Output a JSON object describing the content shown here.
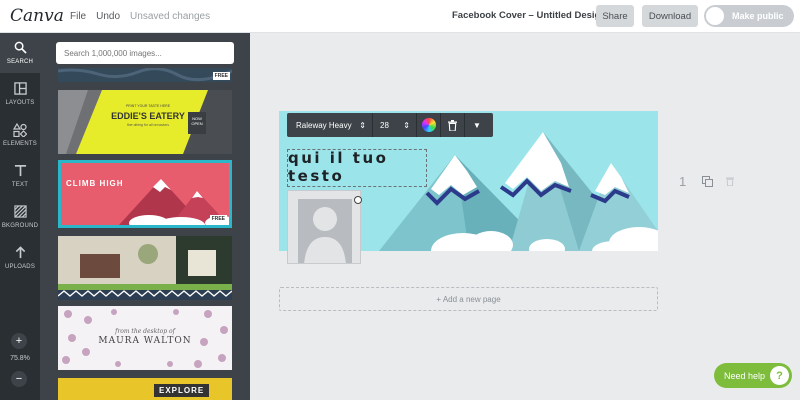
{
  "app": {
    "logo": "Canva"
  },
  "menu": {
    "file": "File",
    "undo": "Undo",
    "status": "Unsaved changes"
  },
  "header": {
    "doc_title": "Facebook Cover – Untitled Design",
    "share": "Share",
    "download": "Download",
    "make_public": "Make public"
  },
  "rail": {
    "items": [
      {
        "label": "SEARCH",
        "icon": "search-icon"
      },
      {
        "label": "LAYOUTS",
        "icon": "layouts-icon"
      },
      {
        "label": "ELEMENTS",
        "icon": "elements-icon"
      },
      {
        "label": "TEXT",
        "icon": "text-icon"
      },
      {
        "label": "BKGROUND",
        "icon": "background-icon"
      },
      {
        "label": "UPLOADS",
        "icon": "uploads-icon"
      }
    ],
    "zoom_plus": "+",
    "zoom_level": "75.8%",
    "zoom_minus": "−"
  },
  "panel": {
    "search_placeholder": "Search 1,000,000 images...",
    "free_badge": "FREE",
    "eatery_line1": "PRINT YOUR TASTE HERE",
    "eatery_title": "EDDIE'S EATERY",
    "eatery_sub": "fine dining for all occasions",
    "eatery_badge": "NOW OPEN",
    "climb_title": "CLIMB HIGH",
    "desk_line": "from the desktop of",
    "desk_name": "MAURA WALTON",
    "explore": "EXPLORE"
  },
  "toolbar": {
    "font": "Raleway Heavy",
    "size": "28",
    "color_hex": "#ffffff"
  },
  "design": {
    "text_line1": "qui il tuo",
    "text_line2": "testo",
    "bg_color": "#9ae4ea"
  },
  "page": {
    "number": "1",
    "add_page": "+ Add a new page"
  },
  "help": {
    "label": "Need help",
    "icon": "?"
  },
  "colors": {
    "topbar": "#ffffff",
    "rail": "#2a2f33",
    "panel": "#3d4348",
    "accent_help": "#7dbd3b",
    "selected_thumb_border": "#2ab7c9"
  }
}
